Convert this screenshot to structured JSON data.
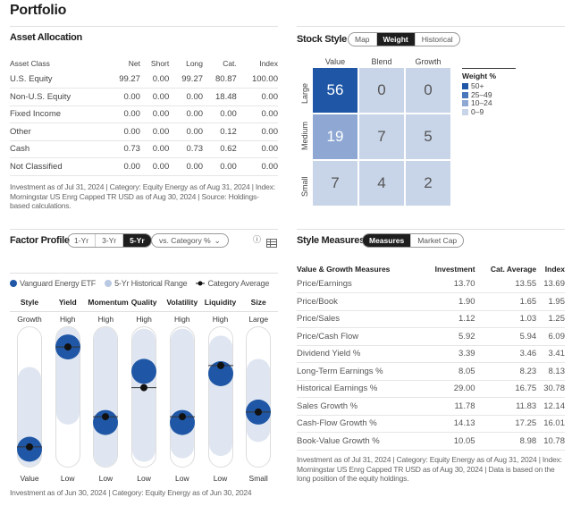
{
  "page": {
    "title": "Portfolio"
  },
  "asset_allocation": {
    "title": "Asset Allocation",
    "columns": [
      "Asset Class",
      "Net",
      "Short",
      "Long",
      "Cat.",
      "Index"
    ],
    "rows": [
      [
        "U.S. Equity",
        "99.27",
        "0.00",
        "99.27",
        "80.87",
        "100.00"
      ],
      [
        "Non-U.S. Equity",
        "0.00",
        "0.00",
        "0.00",
        "18.48",
        "0.00"
      ],
      [
        "Fixed Income",
        "0.00",
        "0.00",
        "0.00",
        "0.00",
        "0.00"
      ],
      [
        "Other",
        "0.00",
        "0.00",
        "0.00",
        "0.12",
        "0.00"
      ],
      [
        "Cash",
        "0.73",
        "0.00",
        "0.73",
        "0.62",
        "0.00"
      ],
      [
        "Not Classified",
        "0.00",
        "0.00",
        "0.00",
        "0.00",
        "0.00"
      ]
    ],
    "note": "Investment as of Jul 31, 2024 | Category: Equity Energy as of Aug 31, 2024 | Index: Morningstar US Enrg Capped TR USD as of Aug 30, 2024 | Source: Holdings-based calculations."
  },
  "stock_style": {
    "title": "Stock Style",
    "tabs": [
      "Map",
      "Weight",
      "Historical"
    ],
    "active_tab": "Weight",
    "columns": [
      "Value",
      "Blend",
      "Growth"
    ],
    "rows": [
      "Large",
      "Medium",
      "Small"
    ],
    "weights": [
      [
        56,
        0,
        0
      ],
      [
        19,
        7,
        5
      ],
      [
        7,
        4,
        2
      ]
    ],
    "legend_title": "Weight %",
    "legend": [
      {
        "label": "50+",
        "color": "#1f57a6"
      },
      {
        "label": "25–49",
        "color": "#4a77bb"
      },
      {
        "label": "10–24",
        "color": "#8ea8d3"
      },
      {
        "label": "0–9",
        "color": "#c8d5e8"
      }
    ]
  },
  "factor_profile": {
    "title": "Factor Profile",
    "periods": [
      "1-Yr",
      "3-Yr",
      "5-Yr"
    ],
    "active_period": "5-Yr",
    "comparison": "vs. Category %",
    "legend": {
      "fund": "Vanguard Energy ETF",
      "range": "5-Yr Historical Range",
      "category": "Category Average"
    },
    "colors": {
      "fund": "#1f57a6",
      "range": "#dfe6f1",
      "category": "#111111"
    },
    "factors": [
      {
        "name": "Style",
        "high": "Growth",
        "low": "Value",
        "fund": 0.05,
        "category": 0.07,
        "range": [
          0.0,
          0.65
        ]
      },
      {
        "name": "Yield",
        "high": "High",
        "low": "Low",
        "fund": 0.93,
        "category": 0.93,
        "range": [
          0.37,
          1.0
        ]
      },
      {
        "name": "Momentum",
        "high": "High",
        "low": "Low",
        "fund": 0.28,
        "category": 0.33,
        "range": [
          0.0,
          1.0
        ]
      },
      {
        "name": "Quality",
        "high": "High",
        "low": "Low",
        "fund": 0.72,
        "category": 0.58,
        "range": [
          0.05,
          0.98
        ]
      },
      {
        "name": "Volatility",
        "high": "High",
        "low": "Low",
        "fund": 0.28,
        "category": 0.33,
        "range": [
          0.08,
          0.98
        ]
      },
      {
        "name": "Liquidity",
        "high": "High",
        "low": "Low",
        "fund": 0.7,
        "category": 0.77,
        "range": [
          0.1,
          0.92
        ]
      },
      {
        "name": "Size",
        "high": "Large",
        "low": "Small",
        "fund": 0.37,
        "category": 0.37,
        "range": [
          0.22,
          0.72
        ]
      }
    ],
    "note": "Investment as of Jun 30, 2024 | Category: Equity Energy as of Jun 30, 2024"
  },
  "style_measures": {
    "title": "Style Measures",
    "tabs": [
      "Measures",
      "Market Cap"
    ],
    "active_tab": "Measures",
    "columns": [
      "Value & Growth Measures",
      "Investment",
      "Cat. Average",
      "Index"
    ],
    "rows": [
      [
        "Price/Earnings",
        "13.70",
        "13.55",
        "13.69"
      ],
      [
        "Price/Book",
        "1.90",
        "1.65",
        "1.95"
      ],
      [
        "Price/Sales",
        "1.12",
        "1.03",
        "1.25"
      ],
      [
        "Price/Cash Flow",
        "5.92",
        "5.94",
        "6.09"
      ],
      [
        "Dividend Yield %",
        "3.39",
        "3.46",
        "3.41"
      ],
      [
        "Long-Term Earnings %",
        "8.05",
        "8.23",
        "8.13"
      ],
      [
        "Historical Earnings %",
        "29.00",
        "16.75",
        "30.78"
      ],
      [
        "Sales Growth %",
        "11.78",
        "11.83",
        "12.14"
      ],
      [
        "Cash-Flow Growth %",
        "14.13",
        "17.25",
        "16.01"
      ],
      [
        "Book-Value Growth %",
        "10.05",
        "8.98",
        "10.78"
      ]
    ],
    "note": "Investment as of Jul 31, 2024 | Category: Equity Energy as of Aug 31, 2024 | Index: Morningstar US Enrg Capped TR USD as of Aug 30, 2024 | Data is based on the long position of the equity holdings."
  }
}
